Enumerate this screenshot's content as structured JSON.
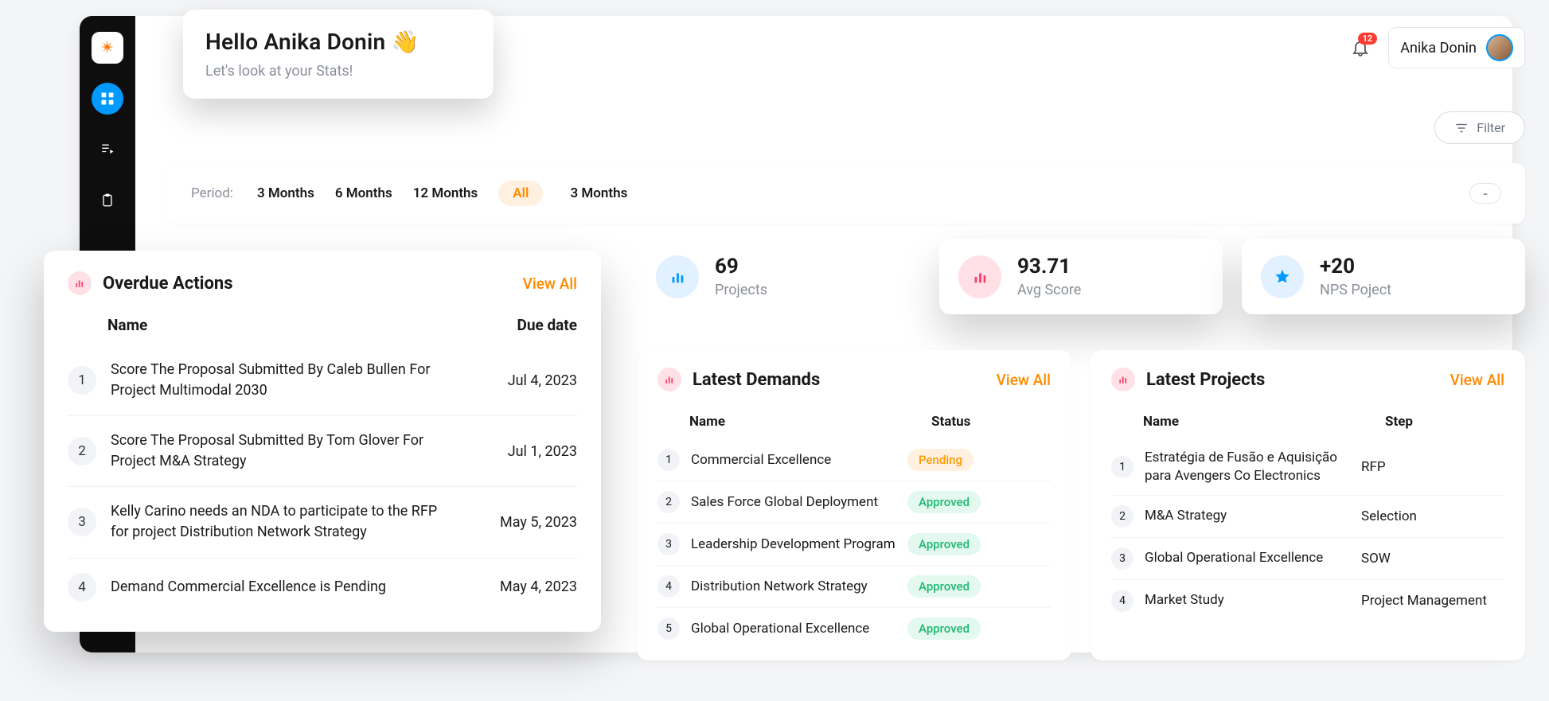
{
  "user": {
    "name": "Anika Donin"
  },
  "notifications": {
    "count": "12"
  },
  "greeting": {
    "title": "Hello Anika Donin 👋",
    "subtitle": "Let's look at your Stats!"
  },
  "filter": {
    "label": "Filter"
  },
  "period": {
    "label": "Period:",
    "options": [
      "3 Months",
      "6 Months",
      "12 Months"
    ],
    "active": "All",
    "extra": "3 Months",
    "dash": "-"
  },
  "overdue": {
    "title": "Overdue Actions",
    "view_all": "View All",
    "cols": {
      "name": "Name",
      "due": "Due date"
    },
    "rows": [
      {
        "n": "1",
        "name": "Score The Proposal Submitted By Caleb Bullen For Project Multimodal 2030",
        "due": "Jul 4, 2023"
      },
      {
        "n": "2",
        "name": "Score The Proposal Submitted By Tom Glover For Project M&A Strategy",
        "due": "Jul 1, 2023"
      },
      {
        "n": "3",
        "name": "Kelly Carino needs an NDA to participate to the RFP for project Distribution Network Strategy",
        "due": "May 5, 2023"
      },
      {
        "n": "4",
        "name": "Demand Commercial Excellence is Pending",
        "due": "May 4, 2023"
      }
    ]
  },
  "stats": {
    "projects": {
      "value": "69",
      "label": "Projects"
    },
    "avg": {
      "value": "93.71",
      "label": "Avg Score"
    },
    "nps": {
      "value": "+20",
      "label": "NPS Poject"
    }
  },
  "demands": {
    "title": "Latest Demands",
    "view_all": "View All",
    "cols": {
      "name": "Name",
      "status": "Status"
    },
    "rows": [
      {
        "n": "1",
        "name": "Commercial Excellence",
        "status": "Pending",
        "kind": "pending"
      },
      {
        "n": "2",
        "name": "Sales Force Global Deployment",
        "status": "Approved",
        "kind": "approved"
      },
      {
        "n": "3",
        "name": "Leadership Development Program",
        "status": "Approved",
        "kind": "approved"
      },
      {
        "n": "4",
        "name": "Distribution Network Strategy",
        "status": "Approved",
        "kind": "approved"
      },
      {
        "n": "5",
        "name": "Global Operational Excellence",
        "status": "Approved",
        "kind": "approved"
      }
    ]
  },
  "projects": {
    "title": "Latest Projects",
    "view_all": "View All",
    "cols": {
      "name": "Name",
      "step": "Step"
    },
    "rows": [
      {
        "n": "1",
        "name": "Estratégia de Fusão e Aquisição para Avengers Co Electronics",
        "step": "RFP"
      },
      {
        "n": "2",
        "name": "M&A Strategy",
        "step": "Selection"
      },
      {
        "n": "3",
        "name": "Global Operational Excellence",
        "step": "SOW"
      },
      {
        "n": "4",
        "name": "Market Study",
        "step": "Project Management"
      }
    ]
  }
}
